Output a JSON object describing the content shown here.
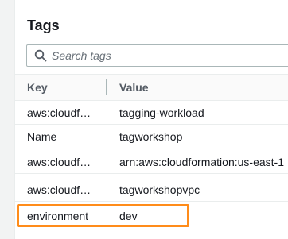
{
  "panel": {
    "title": "Tags"
  },
  "search": {
    "placeholder": "Search tags",
    "value": ""
  },
  "table": {
    "columns": [
      "Key",
      "Value"
    ],
    "rows": [
      {
        "key": "aws:cloudf…",
        "value": "tagging-workload"
      },
      {
        "key": "Name",
        "value": "tagworkshop"
      },
      {
        "key": "aws:cloudf…",
        "value": "arn:aws:cloudformation:us-east-1"
      },
      {
        "key": "aws:cloudf…",
        "value": "tagworkshopvpc"
      },
      {
        "key": "environment",
        "value": "dev"
      }
    ],
    "highlighted_row": 4
  },
  "colors": {
    "highlight": "#ff8c1a",
    "header_text": "#545b64",
    "border": "#eaeded"
  },
  "icons": {
    "search": "search-icon"
  }
}
